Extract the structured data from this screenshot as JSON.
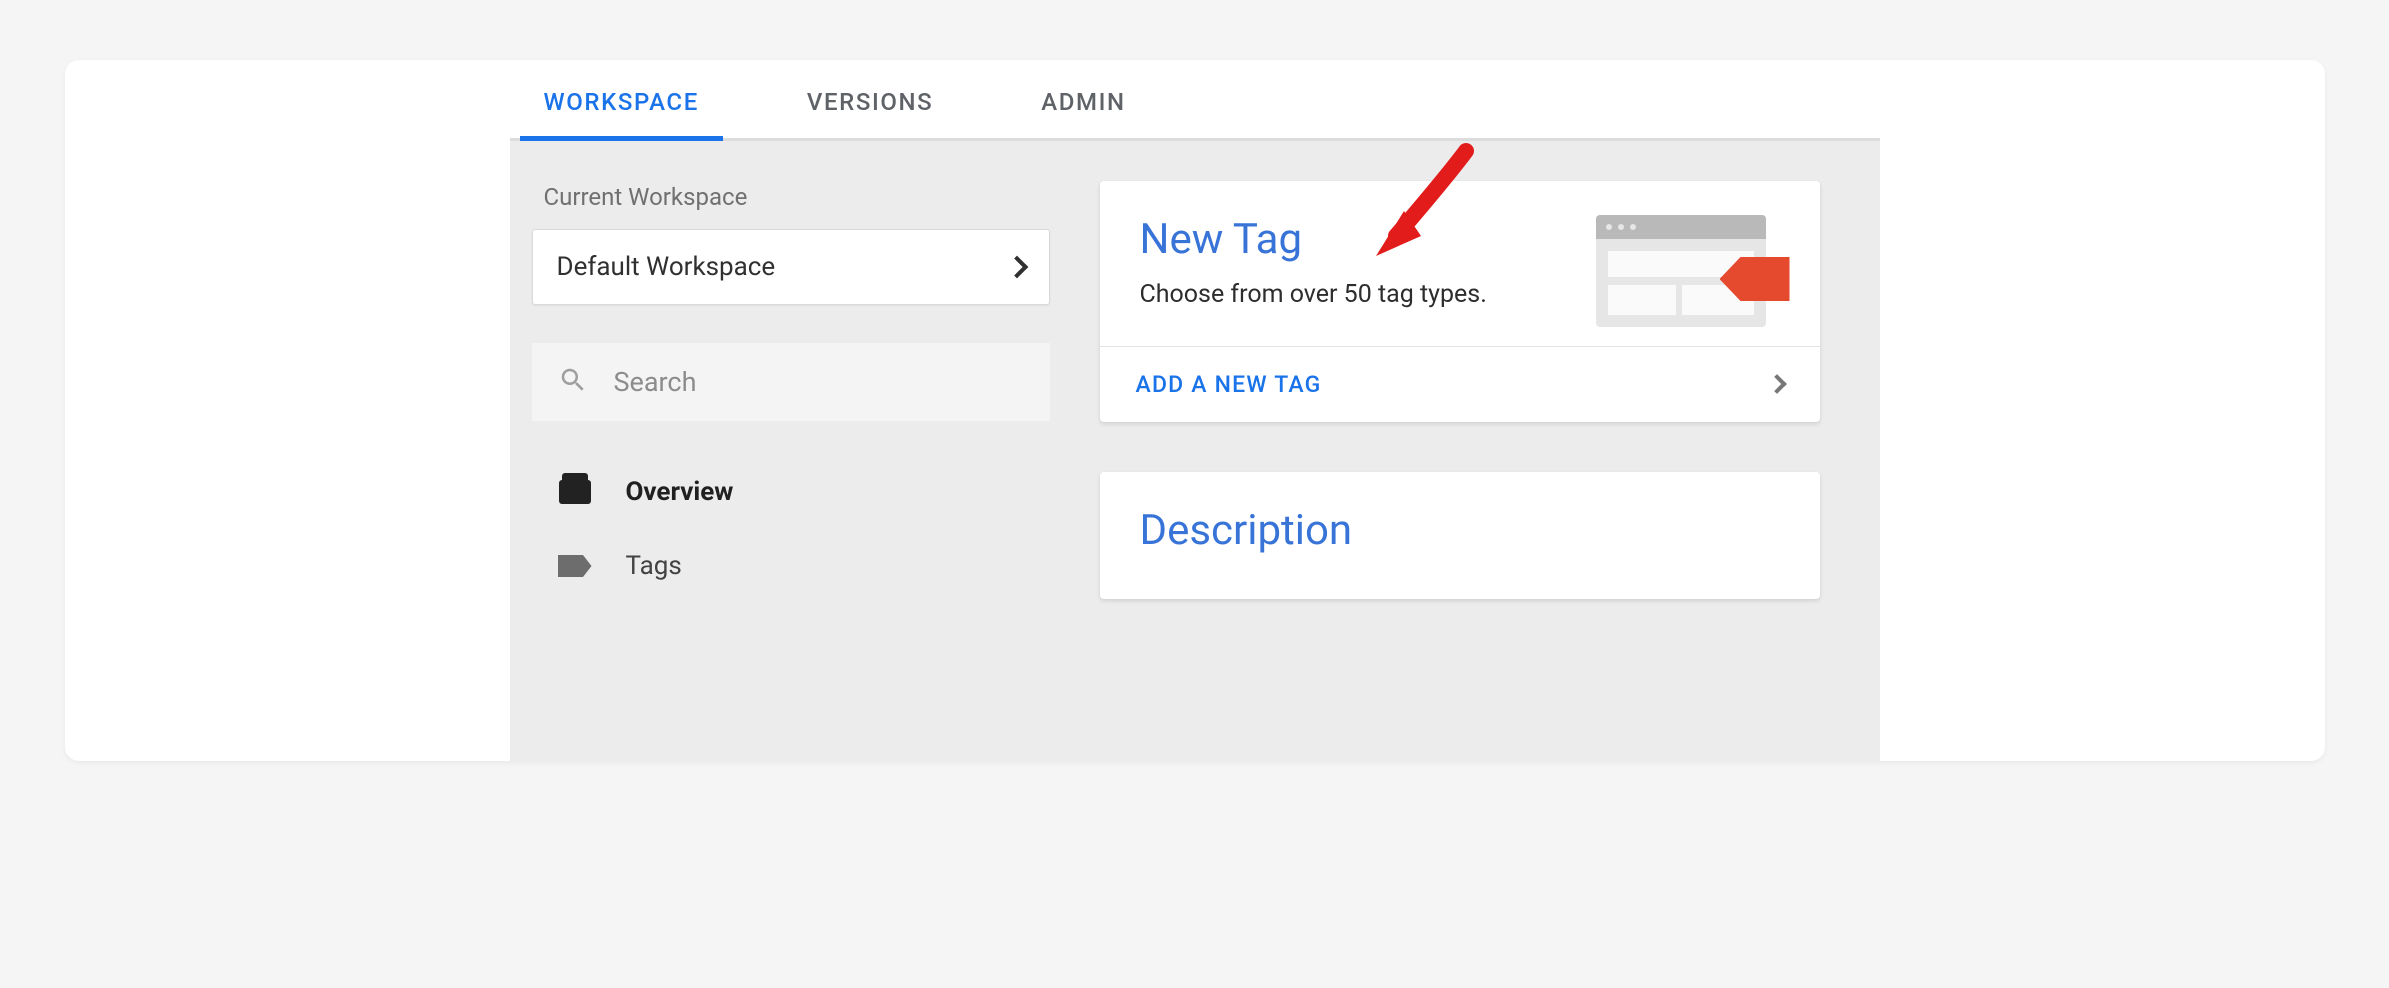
{
  "tabs": {
    "workspace": "WORKSPACE",
    "versions": "VERSIONS",
    "admin": "ADMIN"
  },
  "sidebar": {
    "current_workspace_label": "Current Workspace",
    "workspace_name": "Default Workspace",
    "search_placeholder": "Search",
    "nav": {
      "overview": "Overview",
      "tags": "Tags"
    }
  },
  "cards": {
    "new_tag": {
      "title": "New Tag",
      "subtitle": "Choose from over 50 tag types.",
      "action": "ADD A NEW TAG"
    },
    "description": {
      "title": "Description"
    }
  }
}
